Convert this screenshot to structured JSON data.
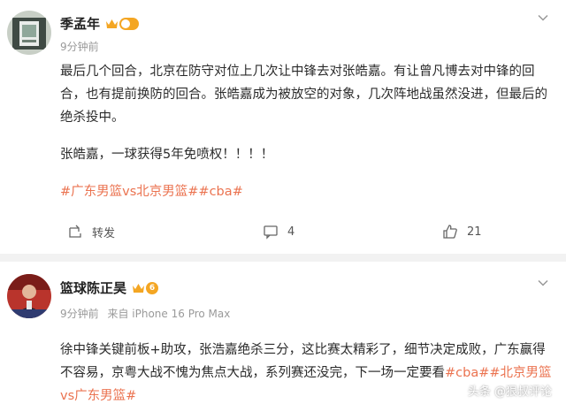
{
  "posts": [
    {
      "author": "季孟年",
      "time": "9分钟前",
      "paragraphs": [
        "最后几个回合，北京在防守对位上几次让中锋去对张皓嘉。有让曾凡博去对中锋的回合，也有提前换防的回合。张皓嘉成为被放空的对象，几次阵地战虽然没进，但最后的绝杀投中。",
        "张皓嘉，一球获得5年免喷权！！！！"
      ],
      "tags": "#广东男篮vs北京男篮##cba#",
      "repost_label": "转发",
      "comment_count": "4",
      "like_count": "21"
    },
    {
      "author": "篮球陈正昊",
      "time": "9分钟前",
      "source": "来自 iPhone 16 Pro Max",
      "level": "6",
      "body_text": "徐中锋关键前板+助攻，张浩嘉绝杀三分，这比赛太精彩了，细节决定成败，广东赢得不容易，京粤大战不愧为焦点大战，系列赛还没完，下一场一定要看",
      "tags": "#cba##北京男篮vs广东男篮#"
    }
  ],
  "watermark": "头条 @狠叔评论",
  "colors": {
    "tag": "#eb7350",
    "badge": "#f4a623"
  }
}
